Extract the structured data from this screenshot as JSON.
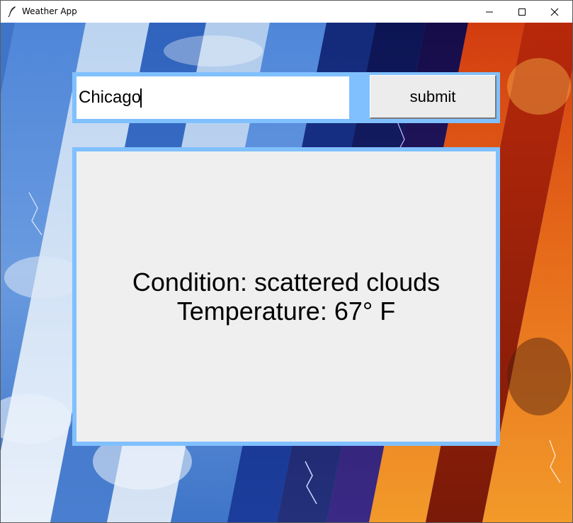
{
  "window": {
    "title": "Weather App",
    "icons": {
      "app": "feather-icon",
      "minimize": "minimize-icon",
      "maximize": "maximize-icon",
      "close": "close-icon"
    }
  },
  "search": {
    "value": "Chicago",
    "submit_label": "submit"
  },
  "result": {
    "condition_line": "Condition: scattered clouds",
    "temperature_line": "Temperature: 67° F"
  },
  "colors": {
    "frame_accent": "#80c0ff",
    "result_background": "#efefef",
    "button_background": "#ececec"
  }
}
